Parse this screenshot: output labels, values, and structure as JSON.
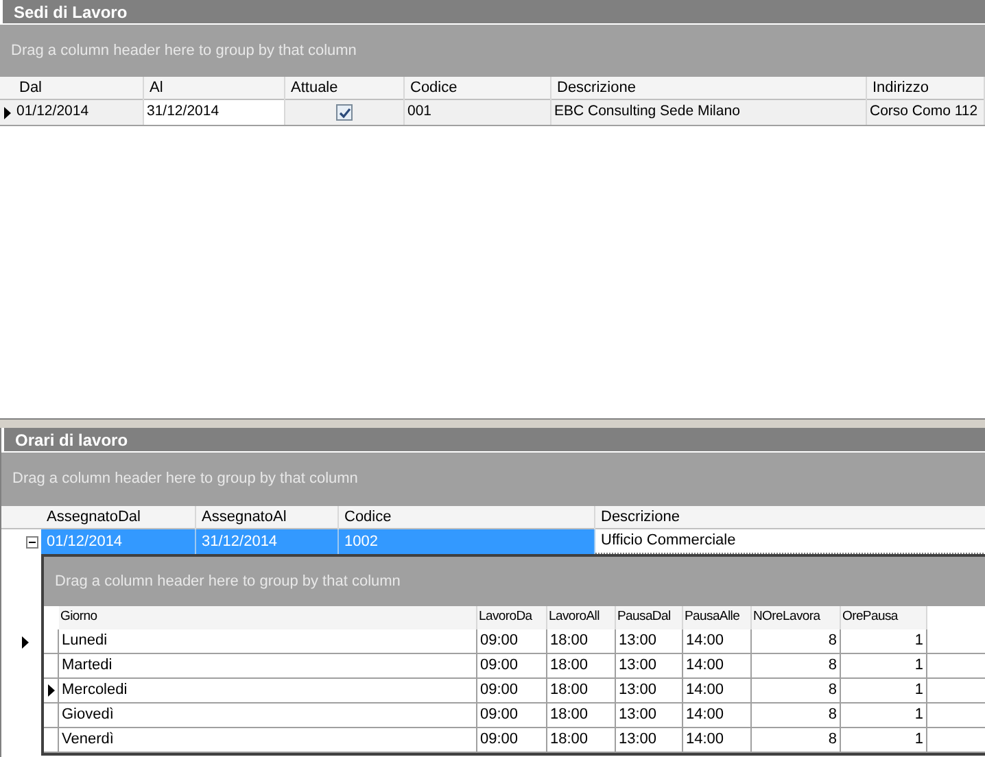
{
  "sedi": {
    "title": "Sedi di Lavoro",
    "group_hint": "Drag a column header here to group by that column",
    "columns": [
      "Dal",
      "Al",
      "Attuale",
      "Codice",
      "Descrizione",
      "Indirizzo"
    ],
    "rows": [
      {
        "selected": true,
        "cells": [
          {
            "kind": "text",
            "text": "01/12/2014"
          },
          {
            "kind": "text",
            "text": "31/12/2014"
          },
          {
            "kind": "check",
            "checked": true
          },
          {
            "kind": "text",
            "text": "001"
          },
          {
            "kind": "text",
            "text": "EBC Consulting Sede Milano"
          },
          {
            "kind": "text",
            "text": "Corso Como 112"
          }
        ]
      }
    ]
  },
  "orari": {
    "title": "Orari di lavoro",
    "group_hint": "Drag a column header here to group by that column",
    "columns": [
      "AssegnatoDal",
      "AssegnatoAl",
      "Codice",
      "Descrizione"
    ],
    "rows": [
      {
        "selected": true,
        "expanded": true,
        "cells": [
          "01/12/2014",
          "31/12/2014",
          "1002",
          "Ufficio Commerciale"
        ],
        "detail": {
          "group_hint": "Drag a column header here to group by that column",
          "columns": [
            "Giorno",
            "LavoroDa",
            "LavoroAll",
            "PausaDal",
            "PausaAlle",
            "NOreLavora",
            "OrePausa"
          ],
          "rows": [
            {
              "selected": false,
              "cells": [
                "Lunedi",
                "09:00",
                "18:00",
                "13:00",
                "14:00",
                "8",
                "1"
              ]
            },
            {
              "selected": false,
              "cells": [
                "Martedi",
                "09:00",
                "18:00",
                "13:00",
                "14:00",
                "8",
                "1"
              ]
            },
            {
              "selected": true,
              "cells": [
                "Mercoledi",
                "09:00",
                "18:00",
                "13:00",
                "14:00",
                "8",
                "1"
              ]
            },
            {
              "selected": false,
              "cells": [
                "Giovedì",
                "09:00",
                "18:00",
                "13:00",
                "14:00",
                "8",
                "1"
              ]
            },
            {
              "selected": false,
              "cells": [
                "Venerdì",
                "09:00",
                "18:00",
                "13:00",
                "14:00",
                "8",
                "1"
              ]
            }
          ]
        }
      }
    ]
  }
}
